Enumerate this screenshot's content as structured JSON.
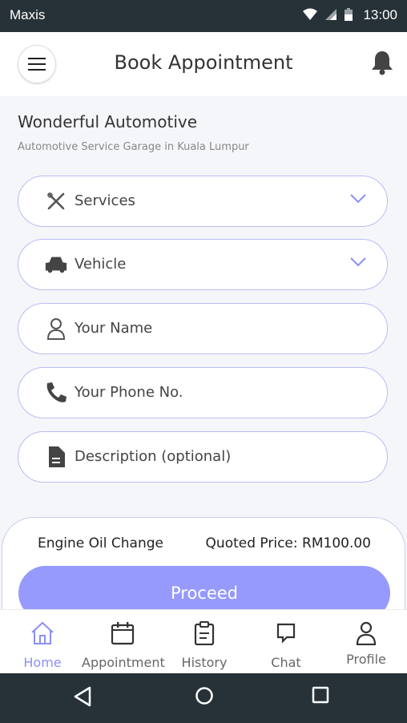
{
  "status_bar": {
    "carrier": "Maxis",
    "time": "13:00"
  },
  "header": {
    "title": "Book Appointment"
  },
  "garage": {
    "name": "Wonderful Automotive",
    "subtitle": "Automotive Service Garage in Kuala Lumpur"
  },
  "form": {
    "services": {
      "label": "Services",
      "icon": "tools-icon"
    },
    "vehicle": {
      "label": "Vehicle",
      "icon": "car-icon"
    },
    "name": {
      "label": "Your Name",
      "icon": "person-icon"
    },
    "phone": {
      "label": "Your Phone No.",
      "icon": "phone-icon"
    },
    "description": {
      "label": "Description (optional)",
      "icon": "document-icon"
    }
  },
  "summary": {
    "service": "Engine Oil Change",
    "quote": "Quoted Price: RM100.00",
    "proceed_label": "Proceed"
  },
  "tabs": [
    {
      "label": "Home",
      "icon": "home-icon",
      "active": true
    },
    {
      "label": "Appointment",
      "icon": "calendar-icon"
    },
    {
      "label": "History",
      "icon": "clipboard-icon"
    },
    {
      "label": "Chat",
      "icon": "chat-icon"
    },
    {
      "label": "Profile",
      "icon": "profile-icon"
    }
  ],
  "colors": {
    "accent": "#959afc",
    "status_bar": "#263238",
    "field_border": "#b9bdf3"
  }
}
